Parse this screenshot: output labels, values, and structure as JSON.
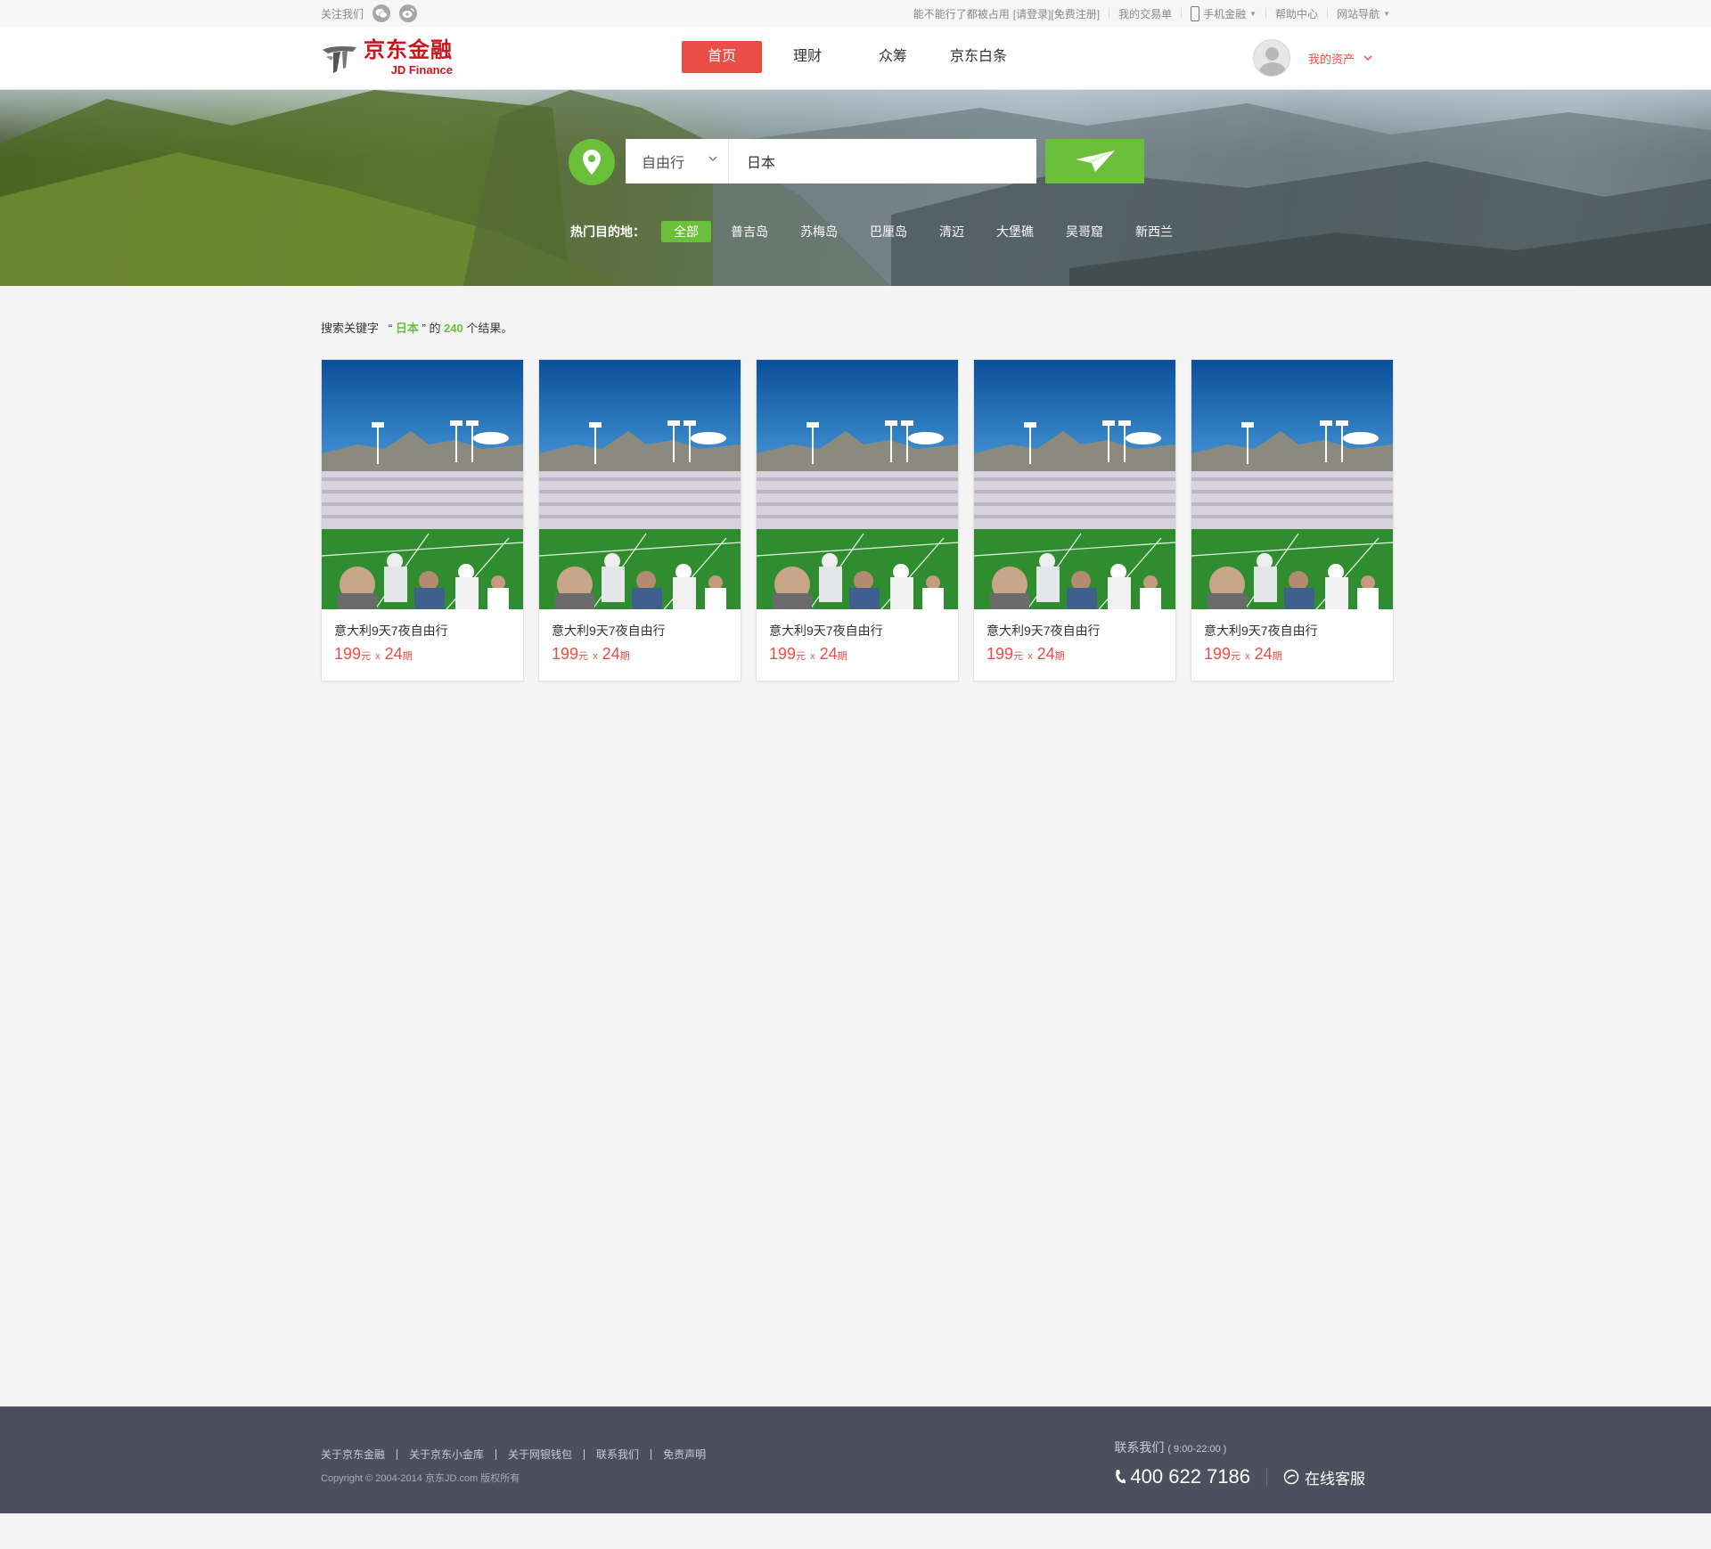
{
  "topbar": {
    "follow_label": "关注我们",
    "login_prompt": "能不能行了都被占用",
    "login": "[请登录]",
    "register": "[免费注册]",
    "my_orders": "我的交易单",
    "mobile_finance": "手机金融",
    "help_center": "帮助中心",
    "site_nav": "网站导航"
  },
  "header": {
    "logo_cn": "京东金融",
    "logo_en": "JD Finance",
    "nav": [
      "首页",
      "理财",
      "众筹",
      "京东白条"
    ],
    "my_assets": "我的资产"
  },
  "search": {
    "type": "自由行",
    "keyword": "日本",
    "hot_label": "热门目的地：",
    "hot_tags": [
      "全部",
      "普吉岛",
      "苏梅岛",
      "巴厘岛",
      "清迈",
      "大堡礁",
      "吴哥窟",
      "新西兰"
    ]
  },
  "results": {
    "prefix": "搜索关键字",
    "open_quote": "“",
    "keyword": "日本",
    "close_quote": "”",
    "middle": "的",
    "count": "240",
    "suffix": "个结果。"
  },
  "products": [
    {
      "title": "意大利9天7夜自由行",
      "price": "199",
      "unit": "元",
      "times": "x",
      "periods": "24",
      "period_unit": "期"
    },
    {
      "title": "意大利9天7夜自由行",
      "price": "199",
      "unit": "元",
      "times": "x",
      "periods": "24",
      "period_unit": "期"
    },
    {
      "title": "意大利9天7夜自由行",
      "price": "199",
      "unit": "元",
      "times": "x",
      "periods": "24",
      "period_unit": "期"
    },
    {
      "title": "意大利9天7夜自由行",
      "price": "199",
      "unit": "元",
      "times": "x",
      "periods": "24",
      "period_unit": "期"
    },
    {
      "title": "意大利9天7夜自由行",
      "price": "199",
      "unit": "元",
      "times": "x",
      "periods": "24",
      "period_unit": "期"
    }
  ],
  "footer": {
    "links": [
      "关于京东金融",
      "关于京东小金库",
      "关于网银钱包",
      "联系我们",
      "免责声明"
    ],
    "copyright": "Copyright © 2004-2014   京东JD.com  版权所有",
    "contact_title": "联系我们",
    "contact_hours": "( 9:00-22:00 )",
    "phone": "400 622 7186",
    "online_service": "在线客服"
  },
  "colors": {
    "brand_red": "#c8161d",
    "accent_red": "#e94e46",
    "accent_green": "#6bbf3a",
    "footer_bg": "#4b505e"
  },
  "icons": [
    "wechat-icon",
    "weibo-icon",
    "phone-icon",
    "location-pin-icon",
    "paper-plane-icon",
    "chevron-down-icon",
    "telephone-icon",
    "chat-icon"
  ]
}
